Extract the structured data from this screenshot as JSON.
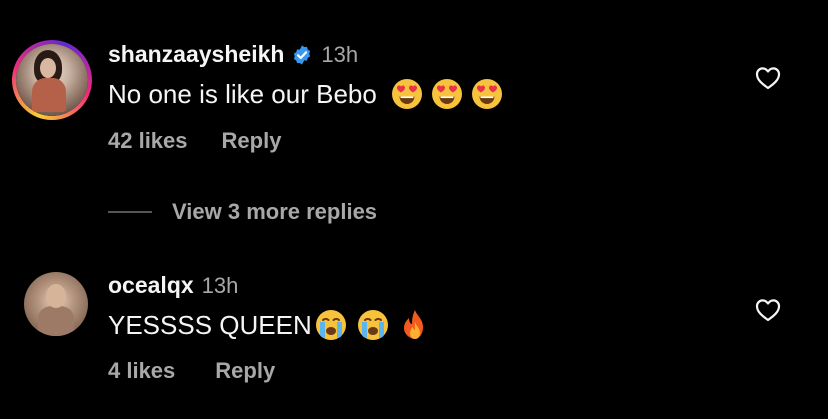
{
  "comments": [
    {
      "username": "shanzaaysheikh",
      "verified": true,
      "time": "13h",
      "text": "No one is like our Bebo",
      "emojis": [
        "heart-eyes",
        "heart-eyes",
        "heart-eyes"
      ],
      "likes": "42 likes",
      "reply_label": "Reply",
      "avatar_ring": true
    },
    {
      "username": "ocealqx",
      "verified": false,
      "time": "13h",
      "text": "YESSSS QUEEN",
      "emojis": [
        "crying",
        "crying",
        "fire"
      ],
      "likes": "4 likes",
      "reply_label": "Reply",
      "avatar_ring": false
    }
  ],
  "view_more": {
    "label": "View 3 more replies"
  },
  "colors": {
    "background": "#000000",
    "text_primary": "#f5f5f5",
    "text_secondary": "#a8a8a8",
    "verified_blue": "#3897f0"
  }
}
